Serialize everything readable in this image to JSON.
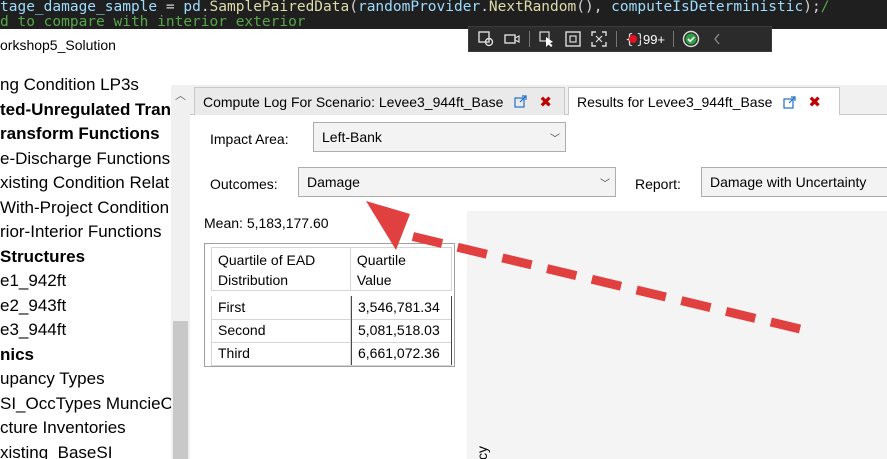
{
  "code": {
    "line1_parts": [
      {
        "text": "tage_damage_sample",
        "color": "#9cdcfe"
      },
      {
        "text": " = ",
        "color": "#d4d4d4"
      },
      {
        "text": "pd",
        "color": "#9cdcfe"
      },
      {
        "text": ".",
        "color": "#d4d4d4"
      },
      {
        "text": "SamplePairedData",
        "color": "#dcdcaa"
      },
      {
        "text": "(",
        "color": "#d4d4d4"
      },
      {
        "text": "randomProvider",
        "color": "#9cdcfe"
      },
      {
        "text": ".",
        "color": "#d4d4d4"
      },
      {
        "text": "NextRandom",
        "color": "#dcdcaa"
      },
      {
        "text": "(), ",
        "color": "#d4d4d4"
      },
      {
        "text": "computeIsDeterministic",
        "color": "#9cdcfe"
      },
      {
        "text": ");",
        "color": "#d4d4d4"
      },
      {
        "text": "/",
        "color": "#57a64a"
      }
    ],
    "line2": "d to compare with interior exterior"
  },
  "debug_toolbar": {
    "badge_count": "99+"
  },
  "window_title": "orkshop5_Solution",
  "tree": {
    "items": [
      {
        "label": "ng Condition LP3s",
        "bold": false
      },
      {
        "label": "ted-Unregulated Tran",
        "bold": true
      },
      {
        "label": "ransform Functions",
        "bold": true
      },
      {
        "label": "e-Discharge Functions",
        "bold": false
      },
      {
        "label": "xisting Condition Relat",
        "bold": false
      },
      {
        "label": "With-Project Condition",
        "bold": false
      },
      {
        "label": "rior-Interior Functions",
        "bold": false
      },
      {
        "label": "Structures",
        "bold": true
      },
      {
        "label": "e1_942ft",
        "bold": false
      },
      {
        "label": "e2_943ft",
        "bold": false
      },
      {
        "label": "e3_944ft",
        "bold": false
      },
      {
        "label": "nics",
        "bold": true
      },
      {
        "label": "upancy Types",
        "bold": false
      },
      {
        "label": "SI_OccTypes MuncieO",
        "bold": false
      },
      {
        "label": "cture Inventories",
        "bold": false
      },
      {
        "label": "xisting_BaseSI",
        "bold": false
      }
    ]
  },
  "tabs": [
    {
      "label": "Compute Log For Scenario: Levee3_944ft_Base",
      "close": "✖"
    },
    {
      "label": "Results for Levee3_944ft_Base",
      "close": "✖"
    }
  ],
  "form": {
    "impact_area_label": "Impact Area:",
    "impact_area_value": "Left-Bank",
    "outcomes_label": "Outcomes:",
    "outcomes_value": "Damage",
    "report_label": "Report:",
    "report_value": "Damage with Uncertainty",
    "mean_label": "Mean:",
    "mean_value": "5,183,177.60"
  },
  "quartile_table": {
    "headers": [
      "Quartile of EAD\nDistribution",
      "Quartile\nValue"
    ],
    "rows": [
      [
        "First",
        "3,546,781.34"
      ],
      [
        "Second",
        "5,081,518.03"
      ],
      [
        "Third",
        "6,661,072.36"
      ]
    ]
  },
  "plot_axis_fragment": "cy",
  "colors": {
    "annotation_arrow": "#e0403f",
    "close_icon": "#c00000",
    "code_bg": "#1f1f1f"
  }
}
